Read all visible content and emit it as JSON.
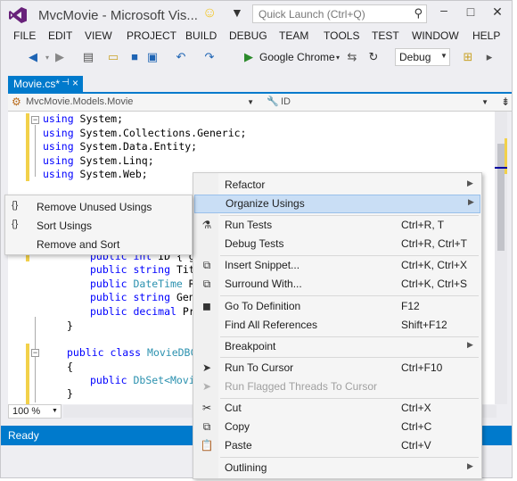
{
  "title_bar": {
    "app_title": "MvcMovie - Microsoft Vis...",
    "quick_launch_placeholder": "Quick Launch (Ctrl+Q)",
    "icons": [
      "vs-logo",
      "feedback-smiley-icon",
      "notifications-filter-icon",
      "search-icon",
      "minimize-icon",
      "maximize-icon",
      "close-icon"
    ]
  },
  "menu": [
    "FILE",
    "EDIT",
    "VIEW",
    "PROJECT",
    "BUILD",
    "DEBUG",
    "TEAM",
    "TOOLS",
    "TEST",
    "WINDOW",
    "HELP"
  ],
  "toolbar": {
    "browser": "Google Chrome",
    "configuration": "Debug"
  },
  "document_tab": {
    "label": "Movie.cs*",
    "pin": "⊣",
    "close": "×"
  },
  "navigation_bar": {
    "type_selector": "MvcMovie.Models.Movie",
    "member_selector": "ID"
  },
  "code_lines": {
    "l1_kw": "using",
    "l1_rest": " System;",
    "l2_kw": "using",
    "l2_rest": " System.Collections.Generic;",
    "l3_kw": "using",
    "l3_rest": " System.Data.Entity;",
    "l4_kw": "using",
    "l4_rest": " System.Linq;",
    "l5_kw": "using",
    "l5_rest": " System.Web;",
    "p1_kw": "public int",
    "p1_rest": " ID { g",
    "p2_kw": "public string",
    "p2_rest": " Tit",
    "p3_kw": "public",
    "p3_type": " DateTime",
    "p3_rest": " R",
    "p4_kw": "public string",
    "p4_rest": " Gen",
    "p5_kw": "public decimal",
    "p5_rest": " Pr",
    "brace_close1": "}",
    "c2_kw": "public class",
    "c2_type": " MovieDBC",
    "brace_open2": "{",
    "d1_kw": "public",
    "d1_type": " DbSet<Movi",
    "brace_close2": "}"
  },
  "editor_footer": {
    "zoom": "100 %"
  },
  "status": {
    "text": "Ready"
  },
  "context_menu": {
    "items": [
      {
        "label": "Refactor",
        "shortcut": "",
        "submenu": true
      },
      {
        "label": "Organize Usings",
        "shortcut": "",
        "submenu": true,
        "highlighted": true
      },
      {
        "label": "Run Tests",
        "shortcut": "Ctrl+R, T"
      },
      {
        "label": "Debug Tests",
        "shortcut": "Ctrl+R, Ctrl+T"
      },
      {
        "label": "Insert Snippet...",
        "shortcut": "Ctrl+K, Ctrl+X"
      },
      {
        "label": "Surround With...",
        "shortcut": "Ctrl+K, Ctrl+S"
      },
      {
        "label": "Go To Definition",
        "shortcut": "F12"
      },
      {
        "label": "Find All References",
        "shortcut": "Shift+F12"
      },
      {
        "label": "Breakpoint",
        "shortcut": "",
        "submenu": true
      },
      {
        "label": "Run To Cursor",
        "shortcut": "Ctrl+F10"
      },
      {
        "label": "Run Flagged Threads To Cursor",
        "shortcut": "",
        "disabled": true
      },
      {
        "label": "Cut",
        "shortcut": "Ctrl+X"
      },
      {
        "label": "Copy",
        "shortcut": "Ctrl+C"
      },
      {
        "label": "Paste",
        "shortcut": "Ctrl+V"
      },
      {
        "label": "Outlining",
        "shortcut": "",
        "submenu": true
      }
    ]
  },
  "organize_usings_submenu": {
    "items": [
      {
        "label": "Remove Unused Usings"
      },
      {
        "label": "Sort Usings"
      },
      {
        "label": "Remove and Sort"
      }
    ]
  },
  "colors": {
    "accent": "#007acc",
    "menu_highlight": "#c9def5",
    "keyword": "#0000ff",
    "type": "#2b91af",
    "change_margin": "#f2d14a"
  }
}
